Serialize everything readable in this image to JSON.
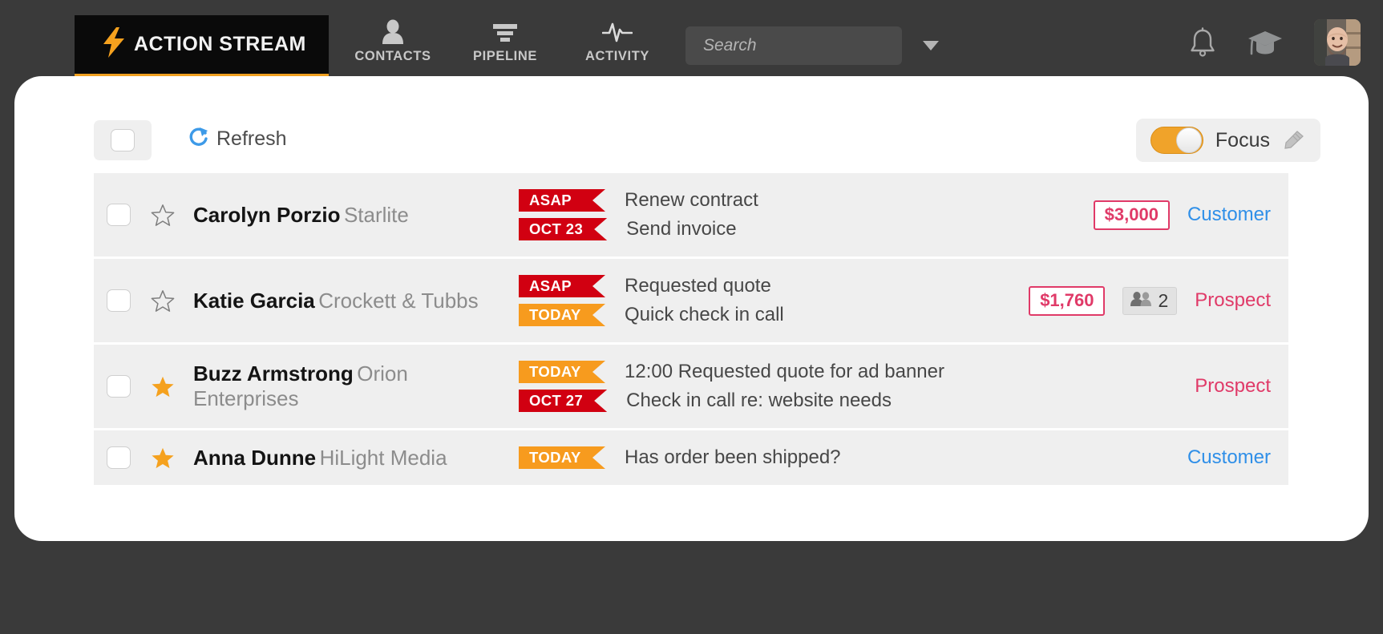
{
  "brand": {
    "name": "ACTION STREAM",
    "bolt_icon": "lightning-bolt-icon",
    "accent": "#f0a020",
    "background": "#0a0a0a"
  },
  "nav": {
    "items": [
      {
        "label": "CONTACTS",
        "icon": "person-icon"
      },
      {
        "label": "PIPELINE",
        "icon": "funnel-icon"
      },
      {
        "label": "ACTIVITY",
        "icon": "pulse-icon"
      }
    ]
  },
  "search": {
    "placeholder": "Search",
    "value": "",
    "dropdown_icon": "chevron-down-icon"
  },
  "topright": {
    "notifications_icon": "bell-icon",
    "learning_icon": "graduation-cap-icon",
    "avatar_icon": "user-avatar"
  },
  "toolbar": {
    "select_all_label": "",
    "refresh_label": "Refresh",
    "refresh_icon": "refresh-icon",
    "focus_label": "Focus",
    "focus_enabled": true,
    "edit_icon": "pencil-icon"
  },
  "rows": [
    {
      "checked": false,
      "starred": false,
      "name": "Carolyn Porzio",
      "company": "Starlite",
      "tasks": [
        {
          "badge": "ASAP",
          "badge_color": "red",
          "text": "Renew contract"
        },
        {
          "badge": "OCT 23",
          "badge_color": "red",
          "text": "Send invoice"
        }
      ],
      "amount": "$3,000",
      "people_count": "",
      "tag": "Customer",
      "tag_type": "customer"
    },
    {
      "checked": false,
      "starred": false,
      "name": "Katie Garcia",
      "company": "Crockett & Tubbs",
      "tasks": [
        {
          "badge": "ASAP",
          "badge_color": "red",
          "text": "Requested quote"
        },
        {
          "badge": "TODAY",
          "badge_color": "orange",
          "text": "Quick check in call"
        }
      ],
      "amount": "$1,760",
      "people_count": "2",
      "tag": "Prospect",
      "tag_type": "prospect"
    },
    {
      "checked": false,
      "starred": true,
      "name": "Buzz Armstrong",
      "company": "Orion Enterprises",
      "tasks": [
        {
          "badge": "TODAY",
          "badge_color": "orange",
          "text": "12:00 Requested quote for ad banner"
        },
        {
          "badge": "OCT 27",
          "badge_color": "red",
          "text": "Check in call re: website needs"
        }
      ],
      "amount": "",
      "people_count": "",
      "tag": "Prospect",
      "tag_type": "prospect"
    },
    {
      "checked": false,
      "starred": true,
      "name": "Anna Dunne",
      "company": "HiLight Media",
      "tasks": [
        {
          "badge": "TODAY",
          "badge_color": "orange",
          "text": "Has order been shipped?"
        }
      ],
      "amount": "",
      "people_count": "",
      "tag": "Customer",
      "tag_type": "customer"
    }
  ],
  "colors": {
    "urgent_red": "#d10011",
    "today_orange": "#f79b1e",
    "money_pink": "#e03a68",
    "customer_blue": "#2f8fe8",
    "toggle_orange": "#f0a32a"
  }
}
